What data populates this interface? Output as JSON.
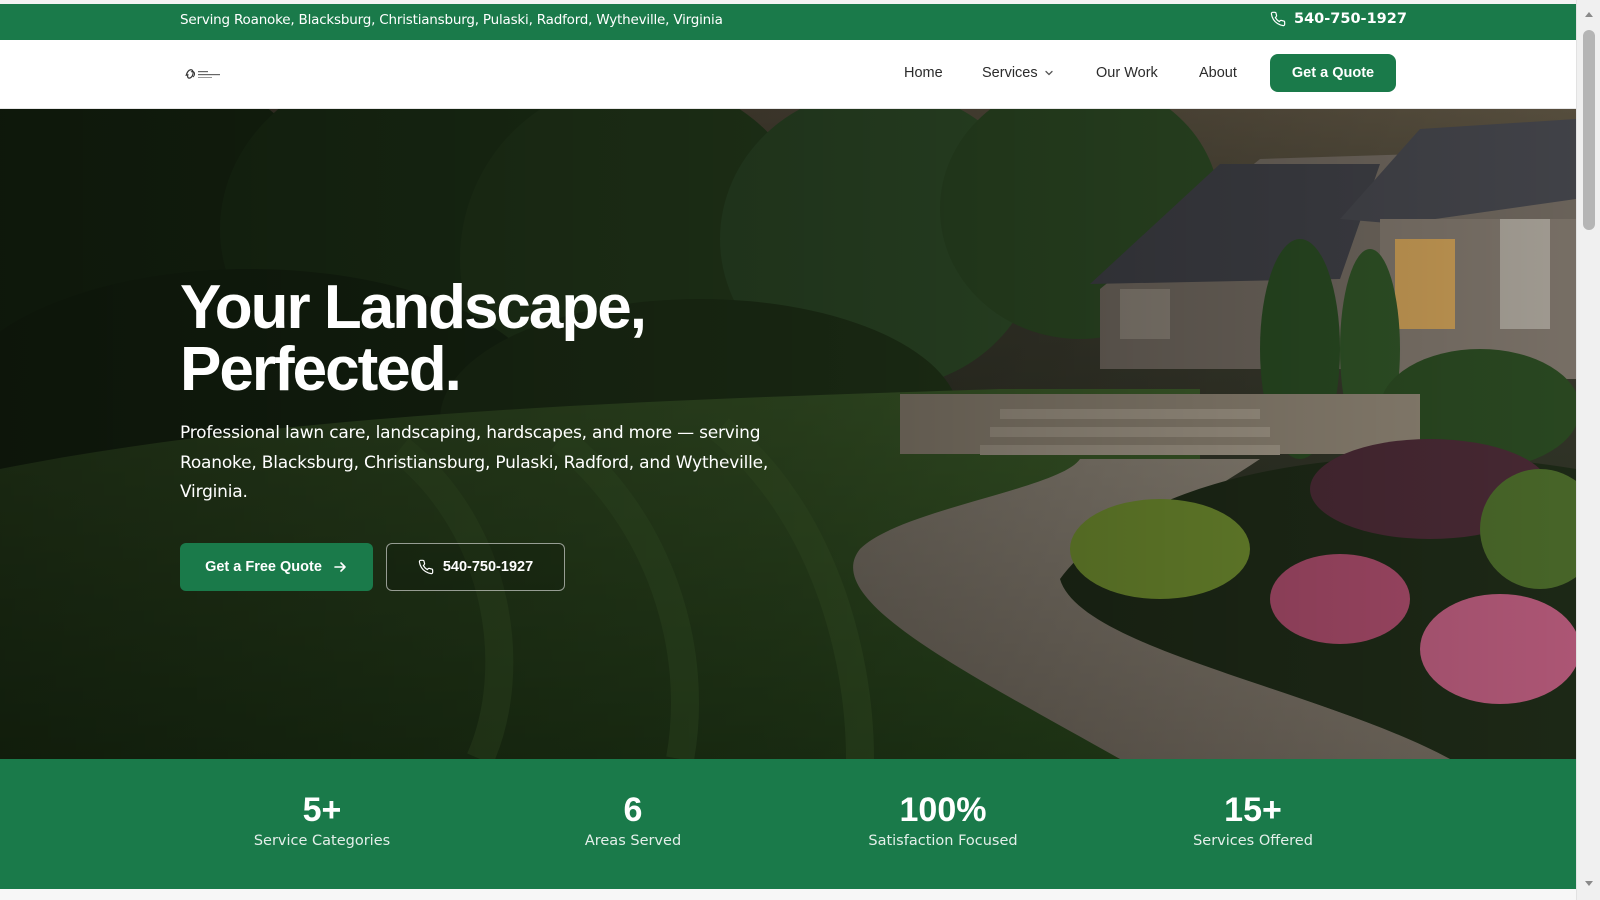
{
  "topbar": {
    "service_areas": "Serving Roanoke, Blacksburg, Christiansburg, Pulaski, Radford, Wytheville, Virginia",
    "phone": "540-750-1927"
  },
  "nav": {
    "links": [
      {
        "label": "Home"
      },
      {
        "label": "Services"
      },
      {
        "label": "Our Work"
      },
      {
        "label": "About"
      }
    ],
    "cta_label": "Get a Quote"
  },
  "hero": {
    "title_line1": "Your Landscape,",
    "title_line2": "Perfected.",
    "subtitle": "Professional lawn care, landscaping, hardscapes, and more — serving Roanoke, Blacksburg, Christiansburg, Pulaski, Radford, and Wytheville, Virginia.",
    "primary_button": "Get a Free Quote",
    "phone_button": "540-750-1927"
  },
  "stats": [
    {
      "value": "5+",
      "label": "Service Categories"
    },
    {
      "value": "6",
      "label": "Areas Served"
    },
    {
      "value": "100%",
      "label": "Satisfaction Focused"
    },
    {
      "value": "15+",
      "label": "Services Offered"
    }
  ],
  "colors": {
    "brand_green": "#1a7a4a",
    "text_dark": "#2b2b2b",
    "white": "#ffffff"
  },
  "icons": [
    "phone-icon",
    "chevron-down-icon",
    "arrow-right-icon",
    "logo-icon"
  ]
}
